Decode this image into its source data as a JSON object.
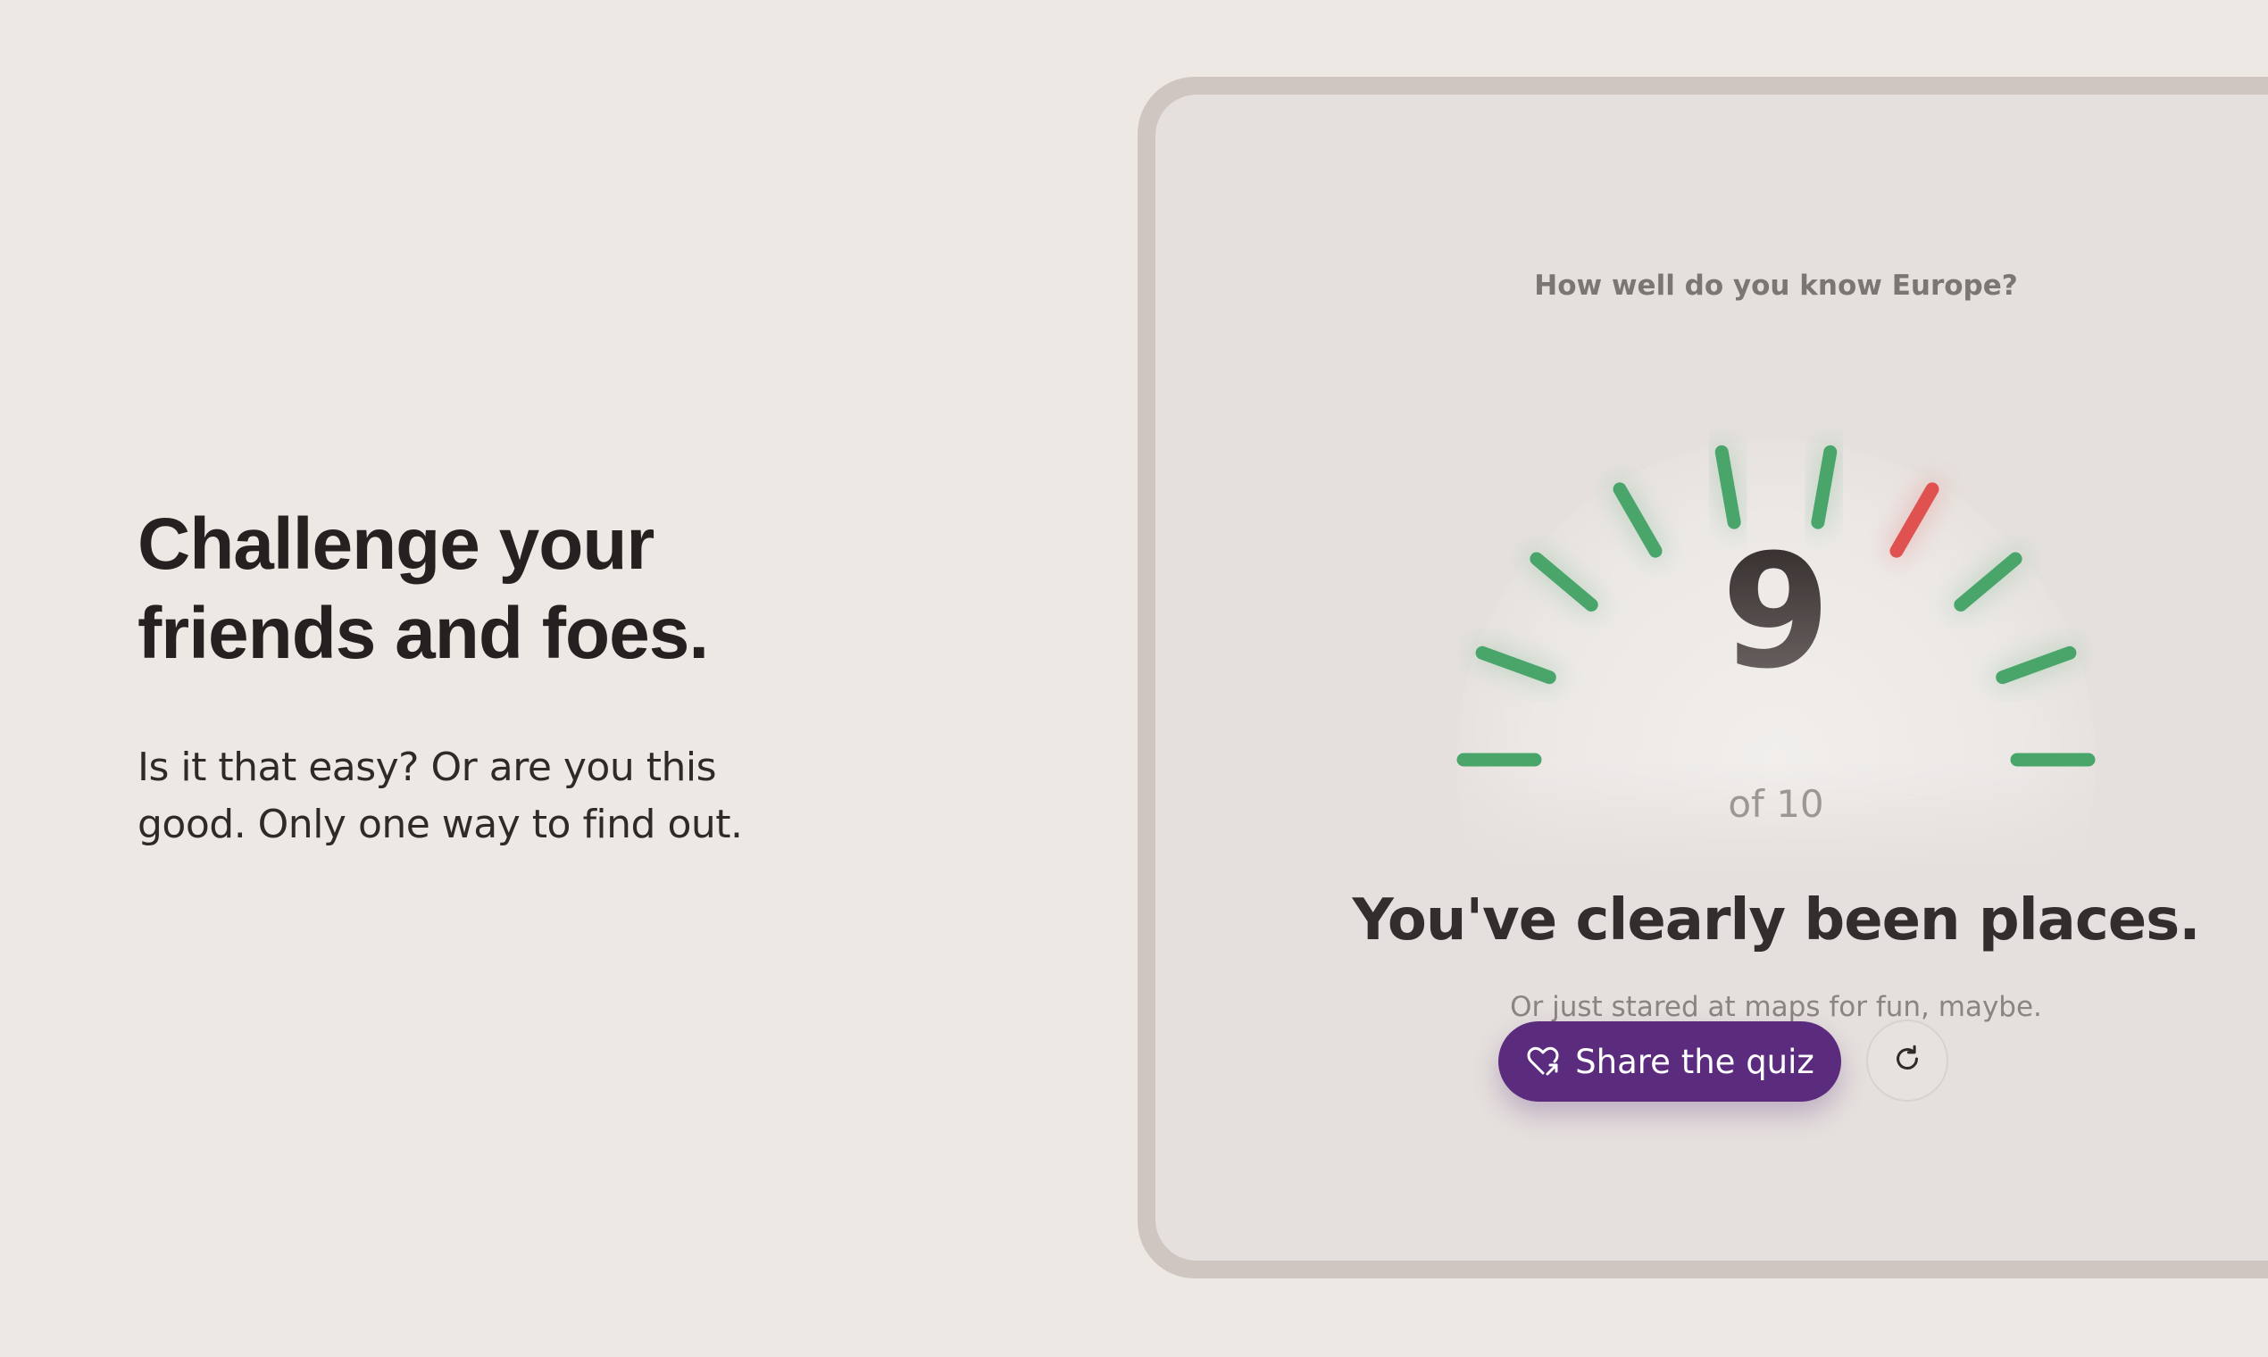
{
  "promo": {
    "headline": "Challenge your friends and foes.",
    "subcopy": "Is it that easy? Or are you this good. Only one way to find out."
  },
  "quiz": {
    "title": "How well do you know Europe?",
    "score": "9",
    "score_total": "of 10",
    "verdict": "You've clearly been places.",
    "verdict_sub": "Or just stared at maps for fun, maybe.",
    "share_label": "Share the quiz",
    "share_icon": "heart-share-icon",
    "restart_icon": "refresh-icon",
    "answers": [
      "correct",
      "correct",
      "correct",
      "correct",
      "correct",
      "correct",
      "wrong",
      "correct",
      "correct",
      "correct"
    ]
  },
  "colors": {
    "correct": "#4aa56b",
    "wrong": "#e0524f",
    "accent": "#5b2c7e"
  }
}
